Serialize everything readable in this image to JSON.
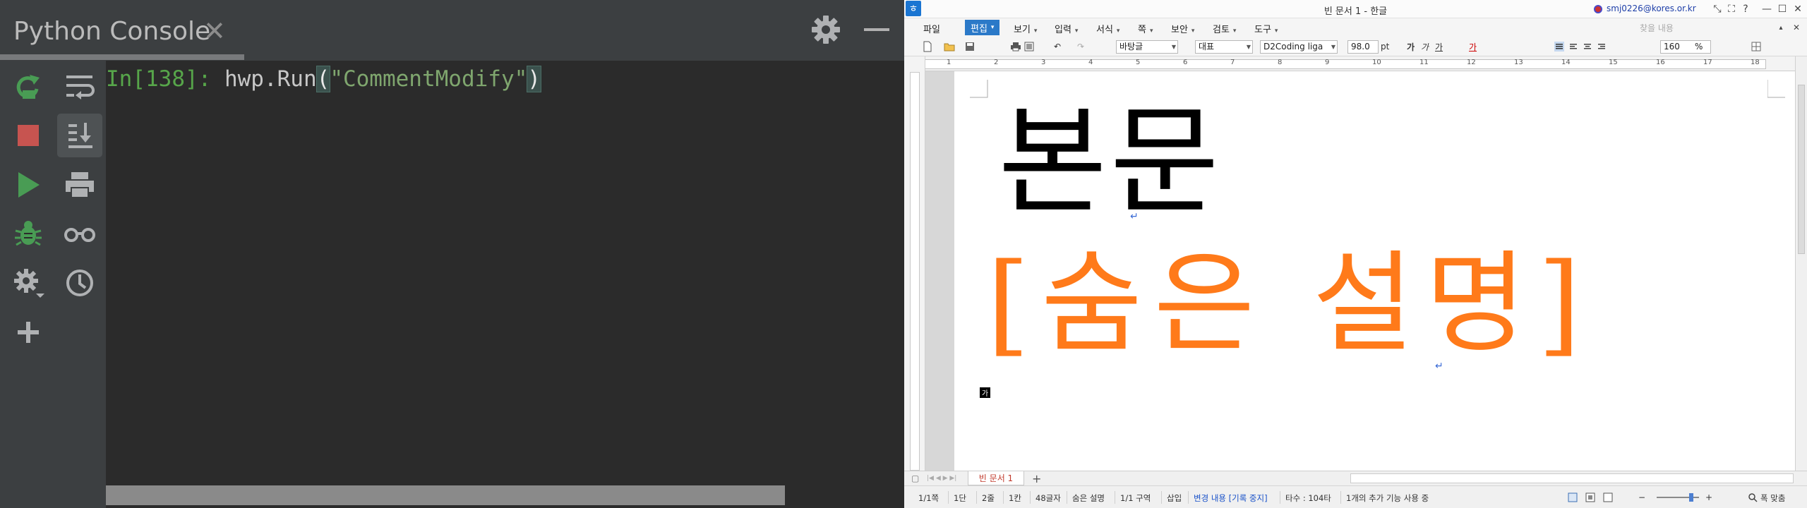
{
  "console": {
    "title": "Python Console",
    "close_glyph": "✕",
    "prompt": "In[138]:",
    "code_prefix": "hwp.Run",
    "paren_open": "(",
    "string_arg": "\"CommentModify\"",
    "paren_close": ")",
    "toolbar": [
      "rerun-icon",
      "stop-icon",
      "soft-wrap-icon",
      "scroll-to-end-icon",
      "run-icon",
      "print-icon",
      "debug-icon",
      "glasses-icon",
      "settings-icon",
      "history-icon",
      "add-icon"
    ],
    "colors": {
      "prompt": "#57a64a",
      "string": "#7fa66e",
      "stop": "#c75450",
      "run": "#499c54",
      "rerun": "#499c54",
      "debug": "#499c54"
    }
  },
  "hwp": {
    "window_title": "빈 문서 1 - 한글",
    "user": "smj0226@kores.or.kr",
    "window_buttons": [
      "⤡",
      "⛶",
      "?",
      "—",
      "☐",
      "✕"
    ],
    "menus": [
      {
        "label": "파일"
      },
      {
        "label": "편집",
        "active": true
      },
      {
        "label": "보기"
      },
      {
        "label": "입력"
      },
      {
        "label": "서식"
      },
      {
        "label": "쪽"
      },
      {
        "label": "보안"
      },
      {
        "label": "검토"
      },
      {
        "label": "도구"
      }
    ],
    "search_placeholder": "찾을 내용",
    "toolbar": {
      "style": "바탕글",
      "font_lang": "대표",
      "font": "D2Coding liga",
      "font_size": "98.0",
      "font_unit": "pt",
      "bold": "가",
      "italic": "가",
      "underline": "가",
      "line_spacing": "160",
      "line_spacing_unit": "%"
    },
    "ruler_numbers": [
      "1",
      "2",
      "3",
      "4",
      "5",
      "6",
      "7",
      "8",
      "9",
      "10",
      "11",
      "12",
      "13",
      "14",
      "15",
      "16",
      "17",
      "18"
    ],
    "body_text": "본문",
    "hidden_comment": "[숨은 설명]",
    "para_mark": "↵",
    "char_mark": "가",
    "doc_tab": "빈 문서 1",
    "add_tab": "+",
    "status": {
      "page": "1/1쪽",
      "section_col": "1단",
      "line": "2줄",
      "column": "1칸",
      "chars": "48글자",
      "hidden": "숨은 설명",
      "area": "1/1 구역",
      "insert": "삽입",
      "track": "변경 내용 [기록 중지]",
      "typing": "타수 : 104타",
      "extra": "1개의 추가 기능 사용 중",
      "fit": "폭 맞춤"
    },
    "colors": {
      "hidden_text": "#ff7a1a",
      "accent": "#2b79c8"
    }
  }
}
